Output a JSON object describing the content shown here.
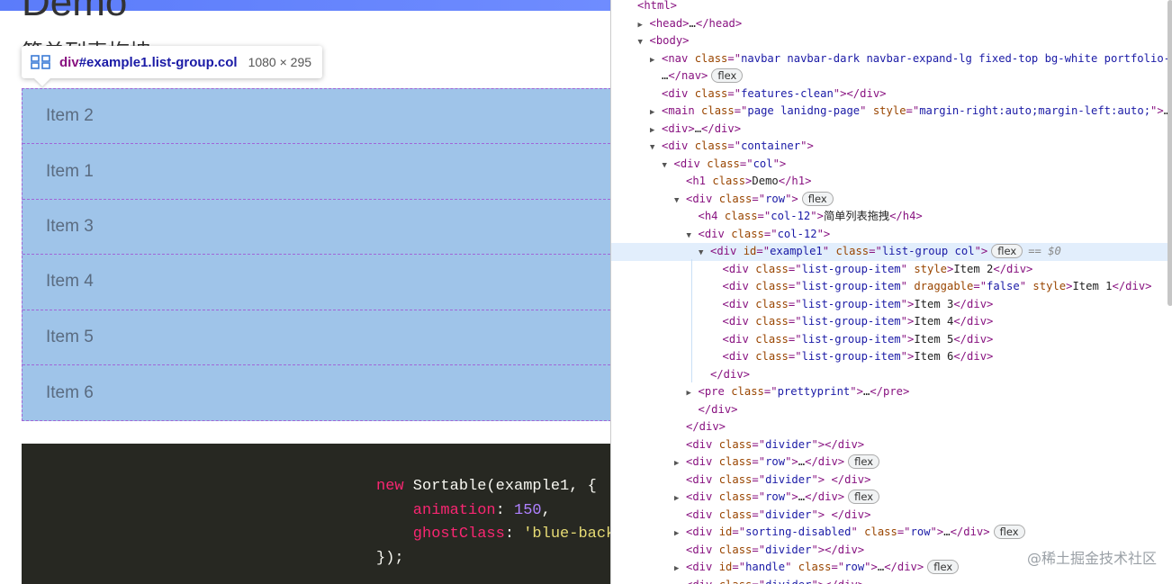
{
  "page": {
    "heading": "Demo",
    "subheading": "简单列表拖拽",
    "tooltip": {
      "selector": "div",
      "selector_id": "#example1.list-group.col",
      "dimensions": "1080 × 295"
    },
    "list_items": [
      "Item 2",
      "Item 1",
      "Item 3",
      "Item 4",
      "Item 5",
      "Item 6"
    ],
    "code_lines": [
      [
        {
          "t": "new",
          "c": "kw"
        },
        {
          "t": " Sortable(example1, {",
          "c": ""
        }
      ],
      [
        {
          "t": "    animation",
          "c": "prop"
        },
        {
          "t": ": ",
          "c": ""
        },
        {
          "t": "150",
          "c": "num"
        },
        {
          "t": ",",
          "c": ""
        }
      ],
      [
        {
          "t": "    ghostClass",
          "c": "prop"
        },
        {
          "t": ": ",
          "c": ""
        },
        {
          "t": "'blue-backg",
          "c": "str"
        }
      ],
      [
        {
          "t": "});",
          "c": ""
        }
      ]
    ]
  },
  "devtools": {
    "selected_hint": "== $0",
    "dots": "•••",
    "lines": [
      {
        "i": 0,
        "tri": "",
        "p": [
          [
            "tag",
            "<html>"
          ]
        ]
      },
      {
        "i": 1,
        "tri": "▶",
        "p": [
          [
            "tag",
            "<head>"
          ],
          [
            "tx",
            "…"
          ],
          [
            "tag",
            "</head>"
          ]
        ]
      },
      {
        "i": 1,
        "tri": "▼",
        "p": [
          [
            "tag",
            "<body>"
          ]
        ]
      },
      {
        "i": 2,
        "tri": "▶",
        "p": [
          [
            "tag",
            "<nav "
          ],
          [
            "an",
            "class"
          ],
          [
            "tag",
            "=\""
          ],
          [
            "av",
            "navbar navbar-dark navbar-expand-lg fixed-top bg-white portfolio-n"
          ]
        ]
      },
      {
        "i": 2,
        "tri": "",
        "p": [
          [
            "tx",
            "…"
          ],
          [
            "tag",
            "</nav>"
          ]
        ],
        "badge": "flex"
      },
      {
        "i": 2,
        "tri": "",
        "p": [
          [
            "tag",
            "<div "
          ],
          [
            "an",
            "class"
          ],
          [
            "tag",
            "=\""
          ],
          [
            "av",
            "features-clean"
          ],
          [
            "tag",
            "\"></div>"
          ]
        ]
      },
      {
        "i": 2,
        "tri": "▶",
        "p": [
          [
            "tag",
            "<main "
          ],
          [
            "an",
            "class"
          ],
          [
            "tag",
            "=\""
          ],
          [
            "av",
            "page lanidng-page"
          ],
          [
            "tag",
            "\" "
          ],
          [
            "an",
            "style"
          ],
          [
            "tag",
            "=\""
          ],
          [
            "av",
            "margin-right:auto;margin-left:auto;"
          ],
          [
            "tag",
            "\">"
          ],
          [
            "tx",
            "…"
          ]
        ]
      },
      {
        "i": 2,
        "tri": "▶",
        "p": [
          [
            "tag",
            "<div>"
          ],
          [
            "tx",
            "…"
          ],
          [
            "tag",
            "</div>"
          ]
        ]
      },
      {
        "i": 2,
        "tri": "▼",
        "p": [
          [
            "tag",
            "<div "
          ],
          [
            "an",
            "class"
          ],
          [
            "tag",
            "=\""
          ],
          [
            "av",
            "container"
          ],
          [
            "tag",
            "\">"
          ]
        ]
      },
      {
        "i": 3,
        "tri": "▼",
        "p": [
          [
            "tag",
            "<div "
          ],
          [
            "an",
            "class"
          ],
          [
            "tag",
            "=\""
          ],
          [
            "av",
            "col"
          ],
          [
            "tag",
            "\">"
          ]
        ]
      },
      {
        "i": 4,
        "tri": "",
        "p": [
          [
            "tag",
            "<h1 "
          ],
          [
            "an",
            "class"
          ],
          [
            "tag",
            ">"
          ],
          [
            "tx",
            "Demo"
          ],
          [
            "tag",
            "</h1>"
          ]
        ]
      },
      {
        "i": 4,
        "tri": "▼",
        "p": [
          [
            "tag",
            "<div "
          ],
          [
            "an",
            "class"
          ],
          [
            "tag",
            "=\""
          ],
          [
            "av",
            "row"
          ],
          [
            "tag",
            "\">"
          ]
        ],
        "badge": "flex"
      },
      {
        "i": 5,
        "tri": "",
        "p": [
          [
            "tag",
            "<h4 "
          ],
          [
            "an",
            "class"
          ],
          [
            "tag",
            "=\""
          ],
          [
            "av",
            "col-12"
          ],
          [
            "tag",
            "\">"
          ],
          [
            "tx",
            "简单列表拖拽"
          ],
          [
            "tag",
            "</h4>"
          ]
        ]
      },
      {
        "i": 5,
        "tri": "▼",
        "p": [
          [
            "tag",
            "<div "
          ],
          [
            "an",
            "class"
          ],
          [
            "tag",
            "=\""
          ],
          [
            "av",
            "col-12"
          ],
          [
            "tag",
            "\">"
          ]
        ]
      },
      {
        "i": 6,
        "tri": "▼",
        "sel": true,
        "p": [
          [
            "tag",
            "<div "
          ],
          [
            "an",
            "id"
          ],
          [
            "tag",
            "=\""
          ],
          [
            "av",
            "example1"
          ],
          [
            "tag",
            "\" "
          ],
          [
            "an",
            "class"
          ],
          [
            "tag",
            "=\""
          ],
          [
            "av",
            "list-group col"
          ],
          [
            "tag",
            "\">"
          ]
        ],
        "badge": "flex"
      },
      {
        "i": 7,
        "tri": "",
        "p": [
          [
            "tag",
            "<div "
          ],
          [
            "an",
            "class"
          ],
          [
            "tag",
            "=\""
          ],
          [
            "av",
            "list-group-item"
          ],
          [
            "tag",
            "\" "
          ],
          [
            "an",
            "style"
          ],
          [
            "tag",
            ">"
          ],
          [
            "tx",
            "Item 2"
          ],
          [
            "tag",
            "</div>"
          ]
        ]
      },
      {
        "i": 7,
        "tri": "",
        "p": [
          [
            "tag",
            "<div "
          ],
          [
            "an",
            "class"
          ],
          [
            "tag",
            "=\""
          ],
          [
            "av",
            "list-group-item"
          ],
          [
            "tag",
            "\" "
          ],
          [
            "an",
            "draggable"
          ],
          [
            "tag",
            "=\""
          ],
          [
            "av",
            "false"
          ],
          [
            "tag",
            "\" "
          ],
          [
            "an",
            "style"
          ],
          [
            "tag",
            ">"
          ],
          [
            "tx",
            "Item 1"
          ],
          [
            "tag",
            "</div>"
          ]
        ]
      },
      {
        "i": 7,
        "tri": "",
        "p": [
          [
            "tag",
            "<div "
          ],
          [
            "an",
            "class"
          ],
          [
            "tag",
            "=\""
          ],
          [
            "av",
            "list-group-item"
          ],
          [
            "tag",
            "\">"
          ],
          [
            "tx",
            "Item 3"
          ],
          [
            "tag",
            "</div>"
          ]
        ]
      },
      {
        "i": 7,
        "tri": "",
        "p": [
          [
            "tag",
            "<div "
          ],
          [
            "an",
            "class"
          ],
          [
            "tag",
            "=\""
          ],
          [
            "av",
            "list-group-item"
          ],
          [
            "tag",
            "\">"
          ],
          [
            "tx",
            "Item 4"
          ],
          [
            "tag",
            "</div>"
          ]
        ]
      },
      {
        "i": 7,
        "tri": "",
        "p": [
          [
            "tag",
            "<div "
          ],
          [
            "an",
            "class"
          ],
          [
            "tag",
            "=\""
          ],
          [
            "av",
            "list-group-item"
          ],
          [
            "tag",
            "\">"
          ],
          [
            "tx",
            "Item 5"
          ],
          [
            "tag",
            "</div>"
          ]
        ]
      },
      {
        "i": 7,
        "tri": "",
        "p": [
          [
            "tag",
            "<div "
          ],
          [
            "an",
            "class"
          ],
          [
            "tag",
            "=\""
          ],
          [
            "av",
            "list-group-item"
          ],
          [
            "tag",
            "\">"
          ],
          [
            "tx",
            "Item 6"
          ],
          [
            "tag",
            "</div>"
          ]
        ]
      },
      {
        "i": 6,
        "tri": "",
        "p": [
          [
            "tag",
            "</div>"
          ]
        ]
      },
      {
        "i": 5,
        "tri": "▶",
        "p": [
          [
            "tag",
            "<pre "
          ],
          [
            "an",
            "class"
          ],
          [
            "tag",
            "=\""
          ],
          [
            "av",
            "prettyprint"
          ],
          [
            "tag",
            "\">"
          ],
          [
            "tx",
            "…"
          ],
          [
            "tag",
            "</pre>"
          ]
        ]
      },
      {
        "i": 5,
        "tri": "",
        "p": [
          [
            "tag",
            "</div>"
          ]
        ]
      },
      {
        "i": 4,
        "tri": "",
        "p": [
          [
            "tag",
            "</div>"
          ]
        ]
      },
      {
        "i": 4,
        "tri": "",
        "p": [
          [
            "tag",
            "<div "
          ],
          [
            "an",
            "class"
          ],
          [
            "tag",
            "=\""
          ],
          [
            "av",
            "divider"
          ],
          [
            "tag",
            "\"></div>"
          ]
        ]
      },
      {
        "i": 4,
        "tri": "▶",
        "p": [
          [
            "tag",
            "<div "
          ],
          [
            "an",
            "class"
          ],
          [
            "tag",
            "=\""
          ],
          [
            "av",
            "row"
          ],
          [
            "tag",
            "\">"
          ],
          [
            "tx",
            "…"
          ],
          [
            "tag",
            "</div>"
          ]
        ],
        "badge": "flex"
      },
      {
        "i": 4,
        "tri": "",
        "p": [
          [
            "tag",
            "<div "
          ],
          [
            "an",
            "class"
          ],
          [
            "tag",
            "=\""
          ],
          [
            "av",
            "divider"
          ],
          [
            "tag",
            "\"> </div>"
          ]
        ]
      },
      {
        "i": 4,
        "tri": "▶",
        "p": [
          [
            "tag",
            "<div "
          ],
          [
            "an",
            "class"
          ],
          [
            "tag",
            "=\""
          ],
          [
            "av",
            "row"
          ],
          [
            "tag",
            "\">"
          ],
          [
            "tx",
            "…"
          ],
          [
            "tag",
            "</div>"
          ]
        ],
        "badge": "flex"
      },
      {
        "i": 4,
        "tri": "",
        "p": [
          [
            "tag",
            "<div "
          ],
          [
            "an",
            "class"
          ],
          [
            "tag",
            "=\""
          ],
          [
            "av",
            "divider"
          ],
          [
            "tag",
            "\"> </div>"
          ]
        ]
      },
      {
        "i": 4,
        "tri": "▶",
        "p": [
          [
            "tag",
            "<div "
          ],
          [
            "an",
            "id"
          ],
          [
            "tag",
            "=\""
          ],
          [
            "av",
            "sorting-disabled"
          ],
          [
            "tag",
            "\" "
          ],
          [
            "an",
            "class"
          ],
          [
            "tag",
            "=\""
          ],
          [
            "av",
            "row"
          ],
          [
            "tag",
            "\">"
          ],
          [
            "tx",
            "…"
          ],
          [
            "tag",
            "</div>"
          ]
        ],
        "badge": "flex"
      },
      {
        "i": 4,
        "tri": "",
        "p": [
          [
            "tag",
            "<div "
          ],
          [
            "an",
            "class"
          ],
          [
            "tag",
            "=\""
          ],
          [
            "av",
            "divider"
          ],
          [
            "tag",
            "\"></div>"
          ]
        ]
      },
      {
        "i": 4,
        "tri": "▶",
        "p": [
          [
            "tag",
            "<div "
          ],
          [
            "an",
            "id"
          ],
          [
            "tag",
            "=\""
          ],
          [
            "av",
            "handle"
          ],
          [
            "tag",
            "\" "
          ],
          [
            "an",
            "class"
          ],
          [
            "tag",
            "=\""
          ],
          [
            "av",
            "row"
          ],
          [
            "tag",
            "\">"
          ],
          [
            "tx",
            "…"
          ],
          [
            "tag",
            "</div>"
          ]
        ],
        "badge": "flex"
      },
      {
        "i": 4,
        "tri": "",
        "p": [
          [
            "tag",
            "<div "
          ],
          [
            "an",
            "class"
          ],
          [
            "tag",
            "=\""
          ],
          [
            "av",
            "divider"
          ],
          [
            "tag",
            "\"></div>"
          ]
        ]
      }
    ],
    "watermark": "@稀土掘金技术社区"
  }
}
